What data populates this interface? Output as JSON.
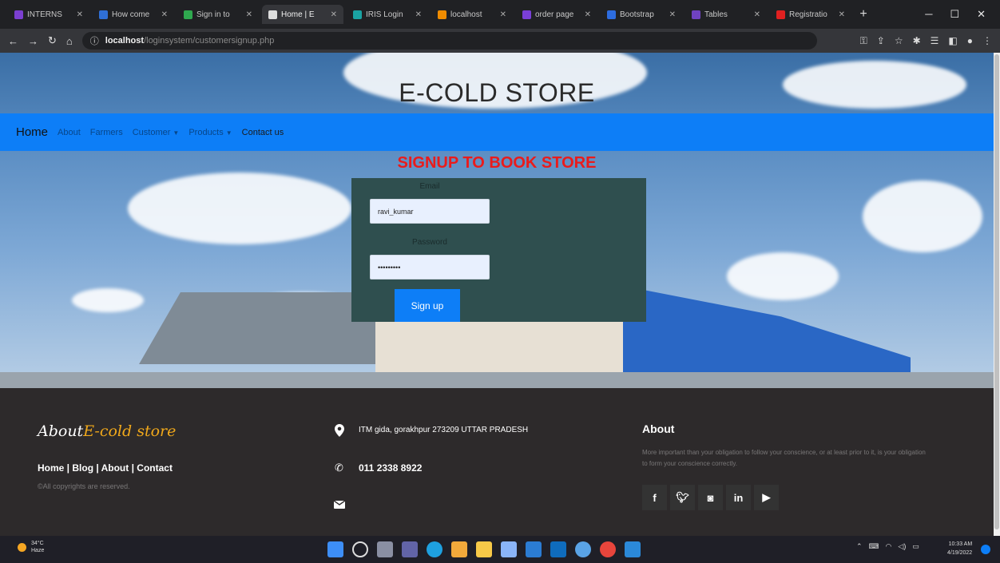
{
  "browser": {
    "tabs": [
      {
        "label": "INTERNS",
        "fav_color": "#7b3fd0"
      },
      {
        "label": "How come",
        "fav_color": "#2f6fd6"
      },
      {
        "label": "Sign in to",
        "fav_color": "#2fa84f"
      },
      {
        "label": "Home | E",
        "fav_color": "#dddddd",
        "active": true
      },
      {
        "label": "IRIS Login",
        "fav_color": "#1aa3a3"
      },
      {
        "label": "localhost",
        "fav_color": "#f08c00"
      },
      {
        "label": "order page",
        "fav_color": "#7a3fd8"
      },
      {
        "label": "Bootstrap",
        "fav_color": "#2d6cdf"
      },
      {
        "label": "Tables",
        "fav_color": "#6f42c1"
      },
      {
        "label": "Registratio",
        "fav_color": "#e02020"
      }
    ],
    "url_host": "localhost",
    "url_path": "/loginsystem/customersignup.php"
  },
  "header": {
    "site_title": "E-COLD STORE"
  },
  "nav": {
    "home": "Home",
    "items": [
      "About",
      "Farmers",
      "Customer",
      "Products"
    ],
    "contact": "Contact us"
  },
  "signup": {
    "heading": "SIGNUP TO BOOK STORE",
    "email_label": "Email",
    "email_value": "ravi_kumar",
    "password_label": "Password",
    "password_value": "•••••••••",
    "button": "Sign up"
  },
  "footer": {
    "about_prefix": "About",
    "about_brand": "E-cold store",
    "links": "Home | Blog | About | Contact",
    "copyright": "©All copyrights are reserved.",
    "address": "ITM gida, gorakhpur 273209 UTTAR PRADESH",
    "phone": "011 2338 8922",
    "about_heading": "About",
    "about_text": "More important than your obligation to follow your conscience, or at least prior to it, is your obligation to form your conscience correctly."
  },
  "taskbar": {
    "temp": "34°C",
    "weather": "Haze",
    "time": "10:33 AM",
    "date": "4/19/2022"
  },
  "colors": {
    "nav_blue": "#0d7ef7",
    "heading_red": "#ea1b1b",
    "form_bg": "#2f4f4f",
    "footer_bg": "#2d2a2b",
    "brand_accent": "#f0a81b"
  }
}
